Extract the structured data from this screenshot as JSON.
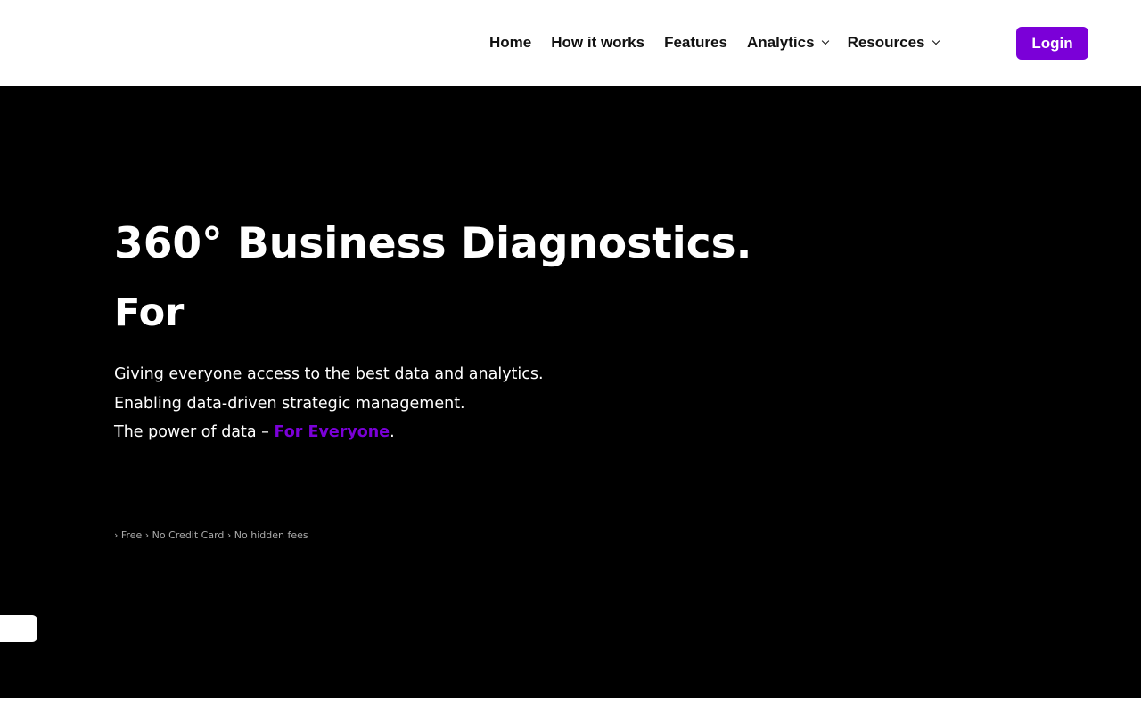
{
  "header": {
    "nav": [
      {
        "label": "Home",
        "dropdown": false
      },
      {
        "label": "How it works",
        "dropdown": false
      },
      {
        "label": "Features",
        "dropdown": false
      },
      {
        "label": "Analytics",
        "dropdown": true
      },
      {
        "label": "Resources",
        "dropdown": true
      }
    ],
    "login_label": "Login"
  },
  "hero": {
    "title": "360° Business Diagnostics.",
    "rotating_prefix": "For",
    "line1": "Giving everyone access to the best data and analytics.",
    "line2": "Enabling data-driven strategic management.",
    "line3_prefix": "The power of data – ",
    "line3_accent": "For Everyone",
    "line3_suffix": ".",
    "perks": "› Free › No Credit Card › No hidden fees"
  },
  "colors": {
    "accent": "#7b00d8",
    "hero_bg": "#000000",
    "header_bg": "#ffffff"
  },
  "icons": {
    "dropdown": "chevron-down-icon"
  }
}
